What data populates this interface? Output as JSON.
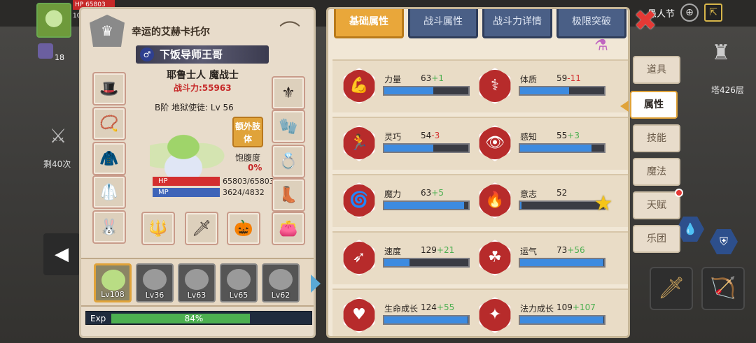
{
  "hud": {
    "hp_label": "HP",
    "hp_value": "65803",
    "level": "10",
    "item_count": "18",
    "remaining": "剩40次",
    "festival": "愚人节",
    "tower_floor": "塔426层"
  },
  "character": {
    "title": "幸运的艾赫卡托尔",
    "gender_symbol": "♂",
    "name": "下饭导师王哥",
    "race_class": "耶鲁士人 魔战士",
    "power_label": "战斗力:55963",
    "rank_line": "B阶 地狱使徒: Lv 56",
    "extra_limb": "额外肢体",
    "satiety_label": "饱腹度",
    "satiety_value": "0%",
    "hp_label": "HP",
    "hp_value": "65803/65803",
    "mp_label": "MP",
    "mp_value": "3624/4832"
  },
  "team": [
    {
      "lv": "Lv108",
      "active": true
    },
    {
      "lv": "Lv36",
      "active": false
    },
    {
      "lv": "Lv63",
      "active": false
    },
    {
      "lv": "Lv65",
      "active": false
    },
    {
      "lv": "Lv62",
      "active": false
    }
  ],
  "exp": {
    "label": "Exp",
    "value": "84%",
    "fraction": 0.84
  },
  "tabs": [
    "基础属性",
    "战斗属性",
    "战斗力详情",
    "极限突破"
  ],
  "attributes": [
    {
      "name": "力量",
      "value": "63",
      "bonus": "+1",
      "fill": 0.58,
      "icon": "muscle-icon"
    },
    {
      "name": "体质",
      "value": "59",
      "bonus": "-11",
      "fill": 0.58,
      "icon": "body-icon"
    },
    {
      "name": "灵巧",
      "value": "54",
      "bonus": "-3",
      "fill": 0.58,
      "icon": "runner-icon"
    },
    {
      "name": "感知",
      "value": "55",
      "bonus": "+3",
      "fill": 0.85,
      "icon": "eye-icon"
    },
    {
      "name": "魔力",
      "value": "63",
      "bonus": "+5",
      "fill": 0.95,
      "icon": "swirl-icon"
    },
    {
      "name": "意志",
      "value": "52",
      "bonus": "",
      "fill": 0.02,
      "icon": "flame-icon"
    },
    {
      "name": "速度",
      "value": "129",
      "bonus": "+21",
      "fill": 0.3,
      "icon": "wing-icon"
    },
    {
      "name": "运气",
      "value": "73",
      "bonus": "+56",
      "fill": 0.99,
      "icon": "clover-icon"
    },
    {
      "name": "生命成长",
      "value": "124",
      "bonus": "+55",
      "fill": 0.99,
      "icon": "heart-icon"
    },
    {
      "name": "法力成长",
      "value": "109",
      "bonus": "+107",
      "fill": 0.99,
      "icon": "star-staff-icon"
    }
  ],
  "side_menu": [
    "道具",
    "属性",
    "技能",
    "魔法",
    "天赋",
    "乐团"
  ]
}
